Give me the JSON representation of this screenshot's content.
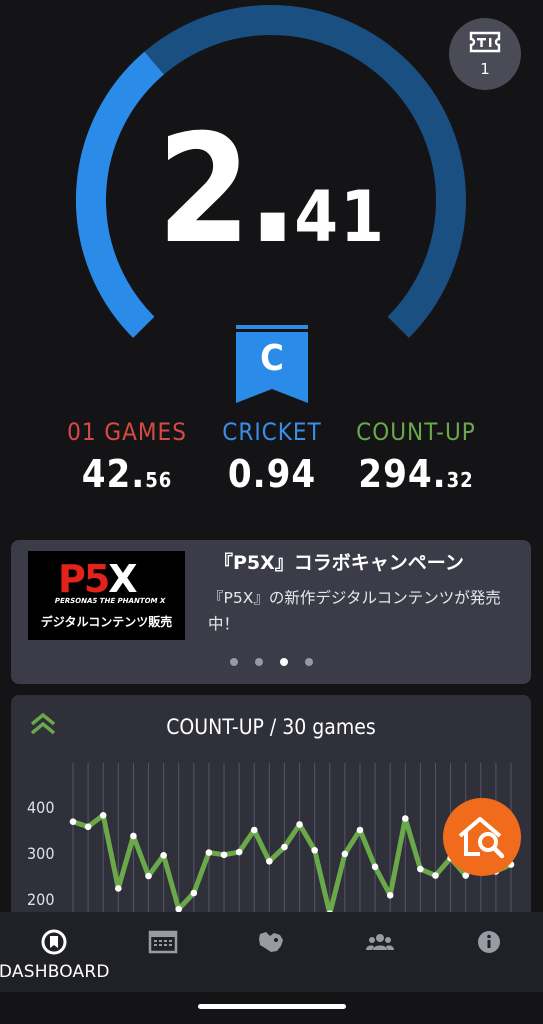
{
  "rating": {
    "value_int": "2.",
    "value_dec": "41",
    "flight_letter": "C",
    "gauge_fill_fraction": 0.35,
    "colors": {
      "arc_bright": "#2b8be8",
      "arc_dark": "#1a4f82",
      "flag": "#2b8be8"
    }
  },
  "tickets": {
    "count": "1",
    "icon": "ticket-icon"
  },
  "stats": {
    "zero_one": {
      "label": "01 GAMES",
      "value_main": "42.",
      "value_dec": "56",
      "color": "#d84a45"
    },
    "cricket": {
      "label": "CRICKET",
      "value_main": "0.94",
      "value_dec": "",
      "color": "#3a8ee8"
    },
    "count_up": {
      "label": "COUNT-UP",
      "value_main": "294.",
      "value_dec": "32",
      "color": "#6aa84a"
    }
  },
  "banner": {
    "title": "『P5X』コラボキャンペーン",
    "description": "『P5X』の新作デジタルコンテンツが発売中！",
    "image": {
      "logo": "P5X",
      "subtitle": "PERSONA5 THE PHANTOM X",
      "caption": "デジタルコンテンツ販売"
    },
    "dots": 4,
    "active_dot": 2
  },
  "chart": {
    "title": "COUNT-UP / 30 games",
    "collapse_icon": "double-chevron-up-icon",
    "fab_icon": "home-search-icon"
  },
  "chart_data": {
    "type": "line",
    "title": "COUNT-UP / 30 games",
    "y_tick_labels": [
      "400",
      "300",
      "200"
    ],
    "ylim": [
      150,
      450
    ],
    "grid": true,
    "series": [
      {
        "values": [
          368,
          357,
          382,
          223,
          337,
          250,
          295,
          178,
          213,
          301,
          296,
          302,
          350,
          282,
          313,
          362,
          306,
          168,
          298,
          350,
          270,
          208,
          375,
          265,
          251,
          289,
          251,
          292,
          260,
          275
        ],
        "color": "#6aa84a"
      }
    ]
  },
  "nav": {
    "items": [
      {
        "label": "DASHBOARD",
        "icon": "dashboard-gauge-icon",
        "active": true
      },
      {
        "label": "",
        "icon": "calendar-icon",
        "active": false
      },
      {
        "label": "",
        "icon": "map-icon",
        "active": false
      },
      {
        "label": "",
        "icon": "friends-icon",
        "active": false
      },
      {
        "label": "",
        "icon": "info-icon",
        "active": false
      }
    ]
  }
}
